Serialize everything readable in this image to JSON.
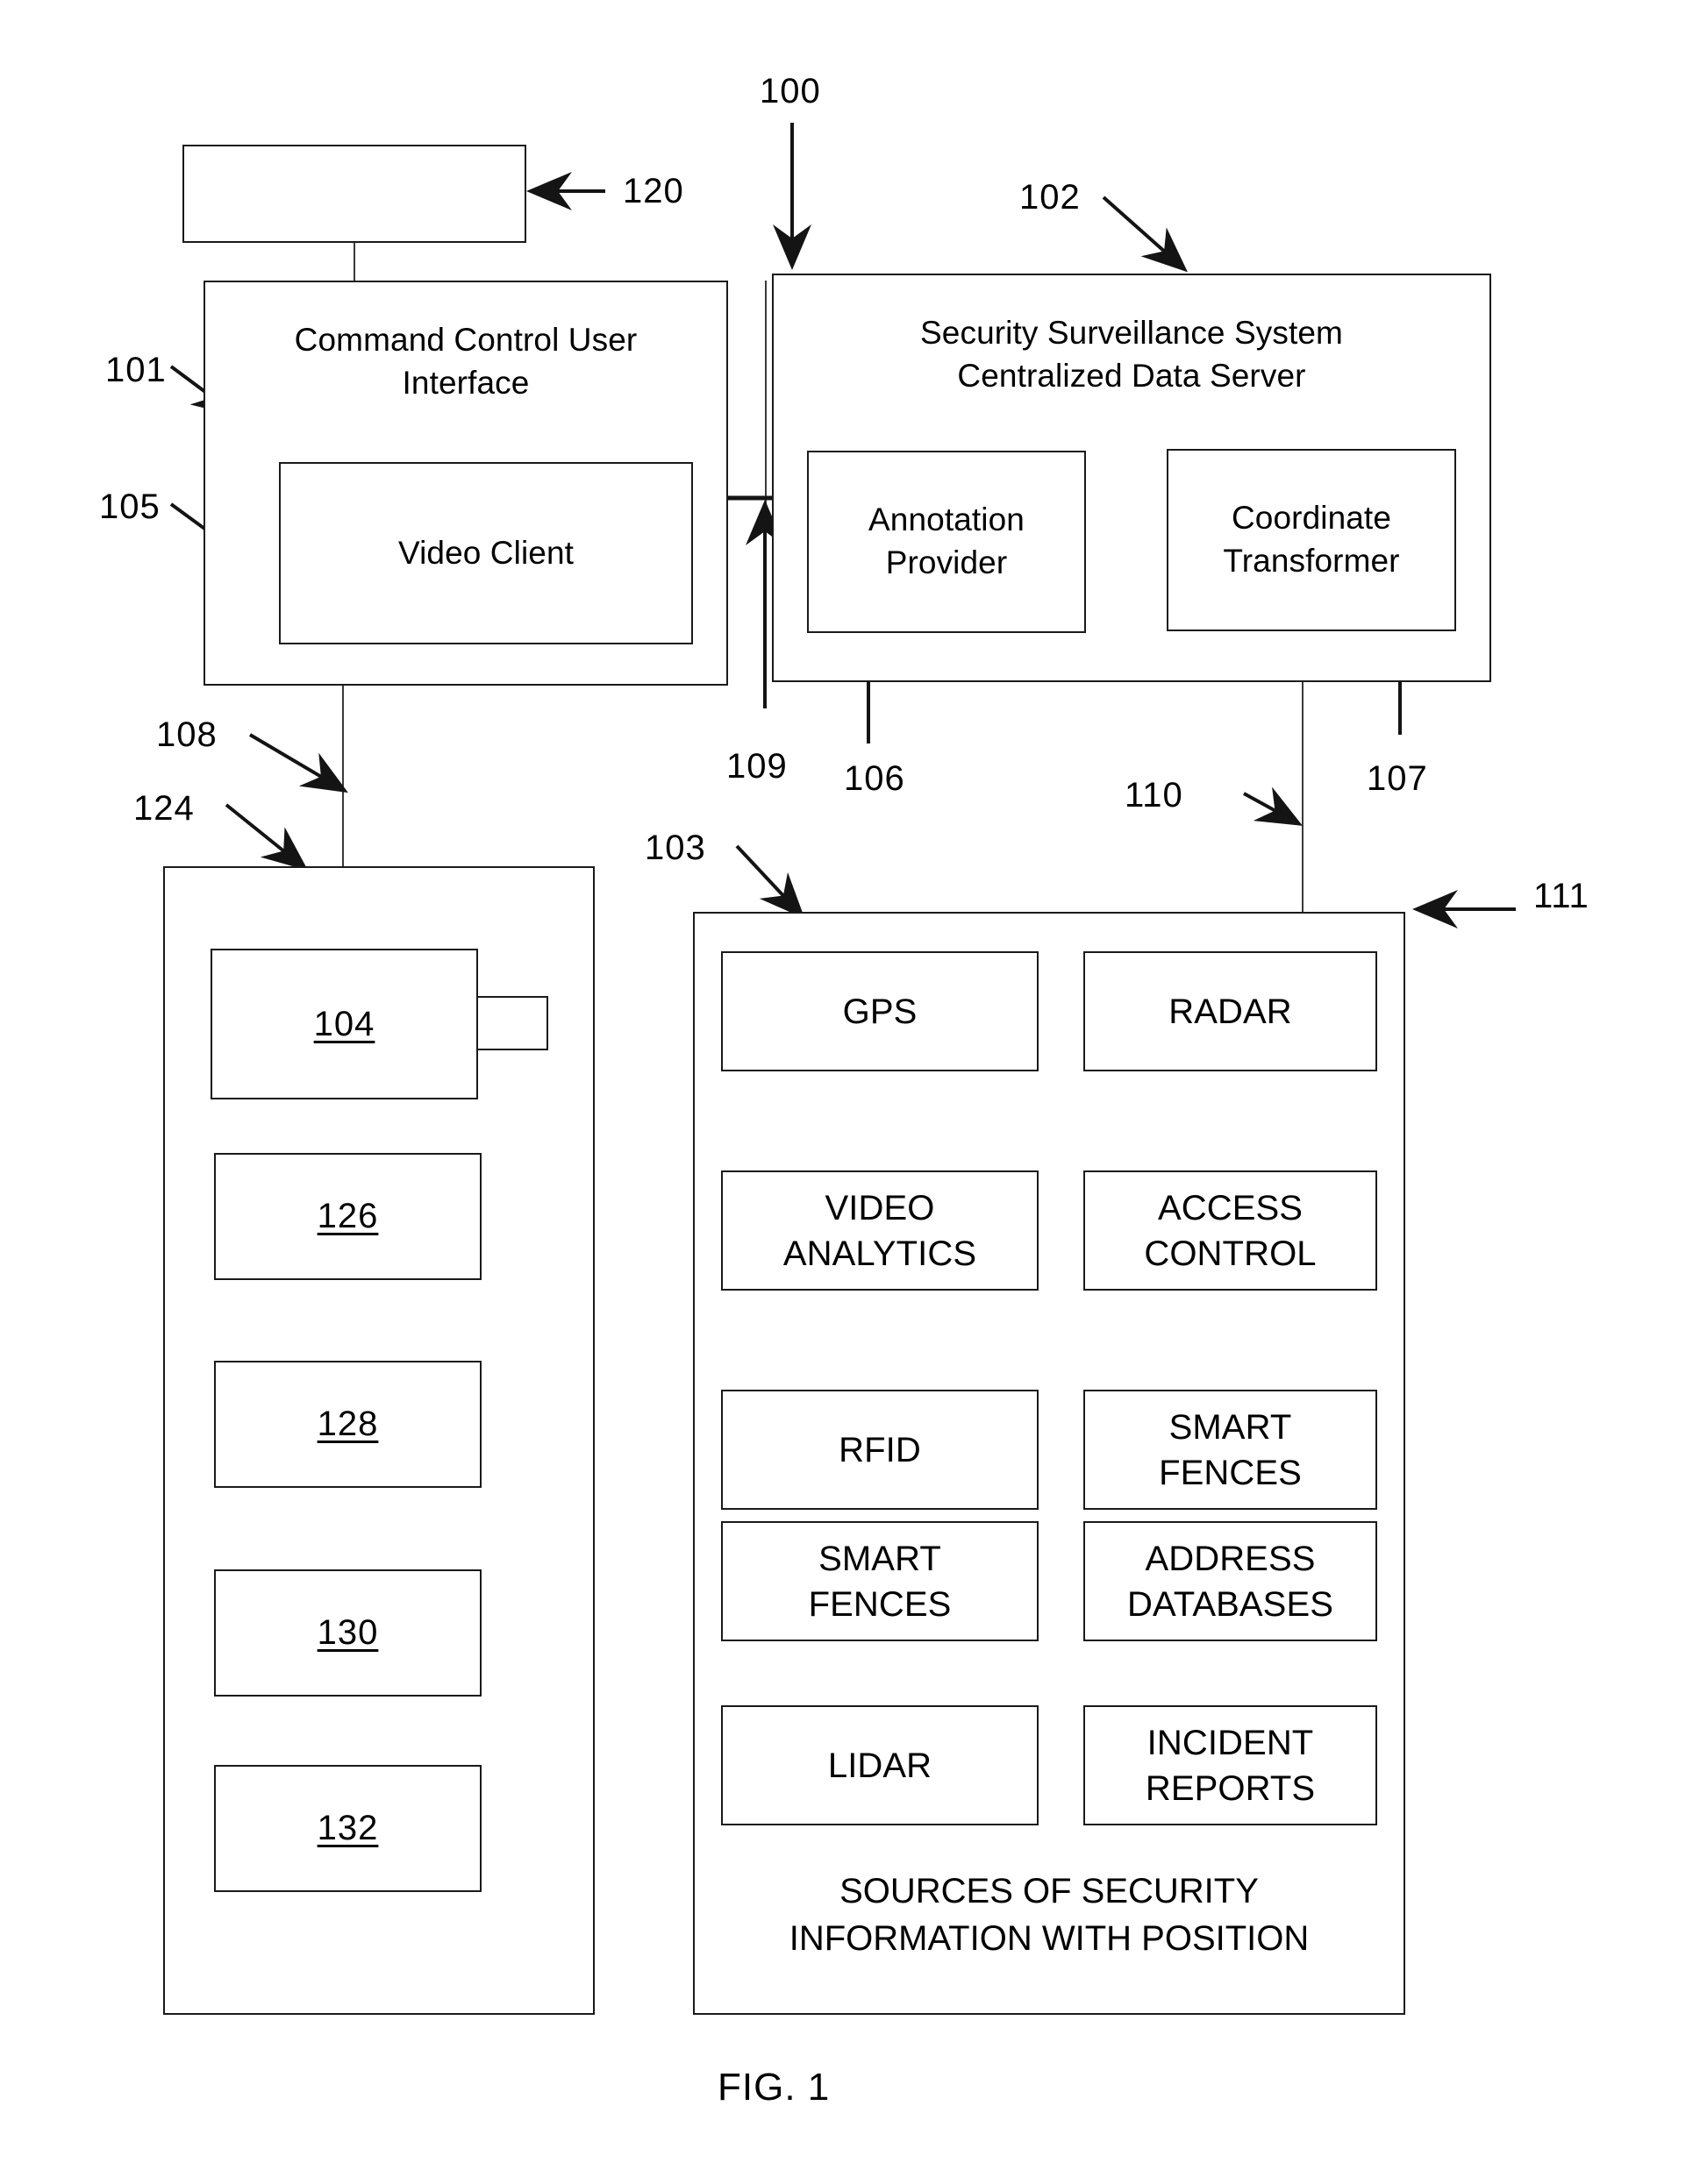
{
  "figure": {
    "caption": "FIG. 1"
  },
  "reference_numerals": {
    "system": "100",
    "command_control_ui": "101",
    "server": "102",
    "sources_panel": "103",
    "camera": "104",
    "video_client": "105",
    "annotation_feed": "106",
    "coordinate_feed": "107",
    "camera_link": "108",
    "client_server_link": "109",
    "transformer_link": "110",
    "sources_pointer": "111",
    "display": "120",
    "site_equipment": "124",
    "device_126": "126",
    "device_128": "128",
    "device_130": "130",
    "device_132": "132"
  },
  "blocks": {
    "display": {
      "label": ""
    },
    "command_control": {
      "label": "Command Control User\nInterface"
    },
    "video_client": {
      "label": "Video Client"
    },
    "server": {
      "label": "Security Surveillance System\nCentralized Data Server"
    },
    "annotation_provider": {
      "label": "Annotation\nProvider"
    },
    "coordinate_transformer": {
      "label": "Coordinate\nTransformer"
    }
  },
  "site_equipment": {
    "items": [
      {
        "number": "104",
        "type": "camera"
      },
      {
        "number": "126",
        "type": "device"
      },
      {
        "number": "128",
        "type": "device"
      },
      {
        "number": "130",
        "type": "device"
      },
      {
        "number": "132",
        "type": "device"
      }
    ]
  },
  "sources_panel": {
    "caption": "SOURCES OF SECURITY\nINFORMATION WITH POSITION",
    "items": [
      {
        "label": "GPS"
      },
      {
        "label": "RADAR"
      },
      {
        "label": "VIDEO\nANALYTICS"
      },
      {
        "label": "ACCESS\nCONTROL"
      },
      {
        "label": "RFID"
      },
      {
        "label": "SMART\nFENCES"
      },
      {
        "label": "SMART\nFENCES"
      },
      {
        "label": "ADDRESS\nDATABASES"
      },
      {
        "label": "LIDAR"
      },
      {
        "label": "INCIDENT\nREPORTS"
      }
    ]
  },
  "colors": {
    "ink": "#1a1a1a",
    "line": "#3a3a3a",
    "background": "#ffffff"
  }
}
